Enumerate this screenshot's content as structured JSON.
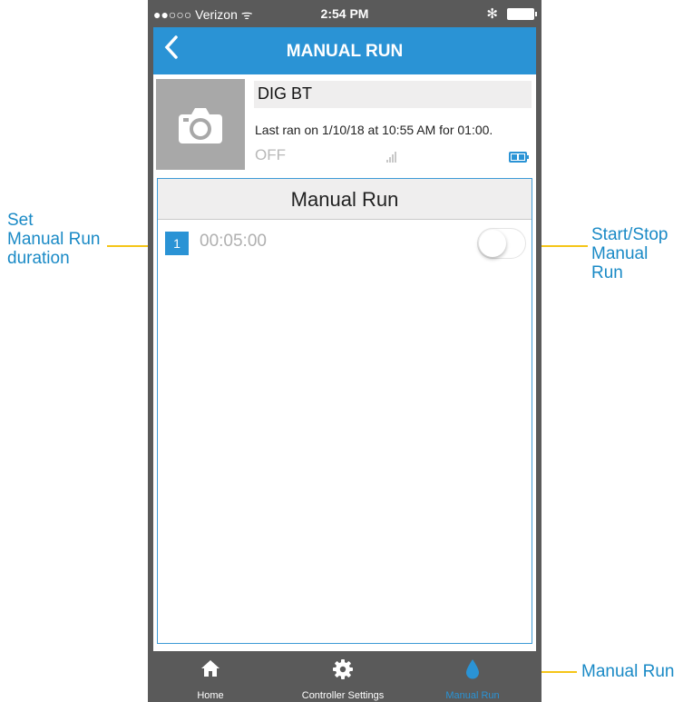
{
  "status_bar": {
    "carrier": "●●○○○ Verizon ᯤ",
    "time": "2:54 PM",
    "bluetooth": "✻"
  },
  "nav": {
    "title": "MANUAL RUN",
    "back_icon": "chevron-left-icon"
  },
  "controller": {
    "name": "DIG BT",
    "last_ran": "Last ran on 1/10/18 at 10:55 AM for 01:00.",
    "state": "OFF",
    "photo_icon": "camera-icon",
    "signal_icon": "signal-strength-icon",
    "battery_icon": "battery-icon"
  },
  "manual_run": {
    "header": "Manual Run",
    "zones": [
      {
        "number": "1",
        "duration": "00:05:00",
        "running": false
      }
    ]
  },
  "tabbar": {
    "items": [
      {
        "label": "Home",
        "icon": "home-icon",
        "active": false
      },
      {
        "label": "Controller Settings",
        "icon": "gear-icon",
        "active": false
      },
      {
        "label": "Manual Run",
        "icon": "water-drop-icon",
        "active": true
      }
    ]
  },
  "annotations": {
    "set_duration": [
      "Set",
      "Manual Run",
      "duration"
    ],
    "start_stop": [
      "Start/Stop",
      "Manual Run"
    ],
    "manual_run_tab": "Manual Run"
  },
  "colors": {
    "accent": "#2a93d5",
    "annotation_text": "#1a8ac6",
    "annotation_marker": "#f5c518",
    "tabbar_bg": "#5a5a5a"
  }
}
